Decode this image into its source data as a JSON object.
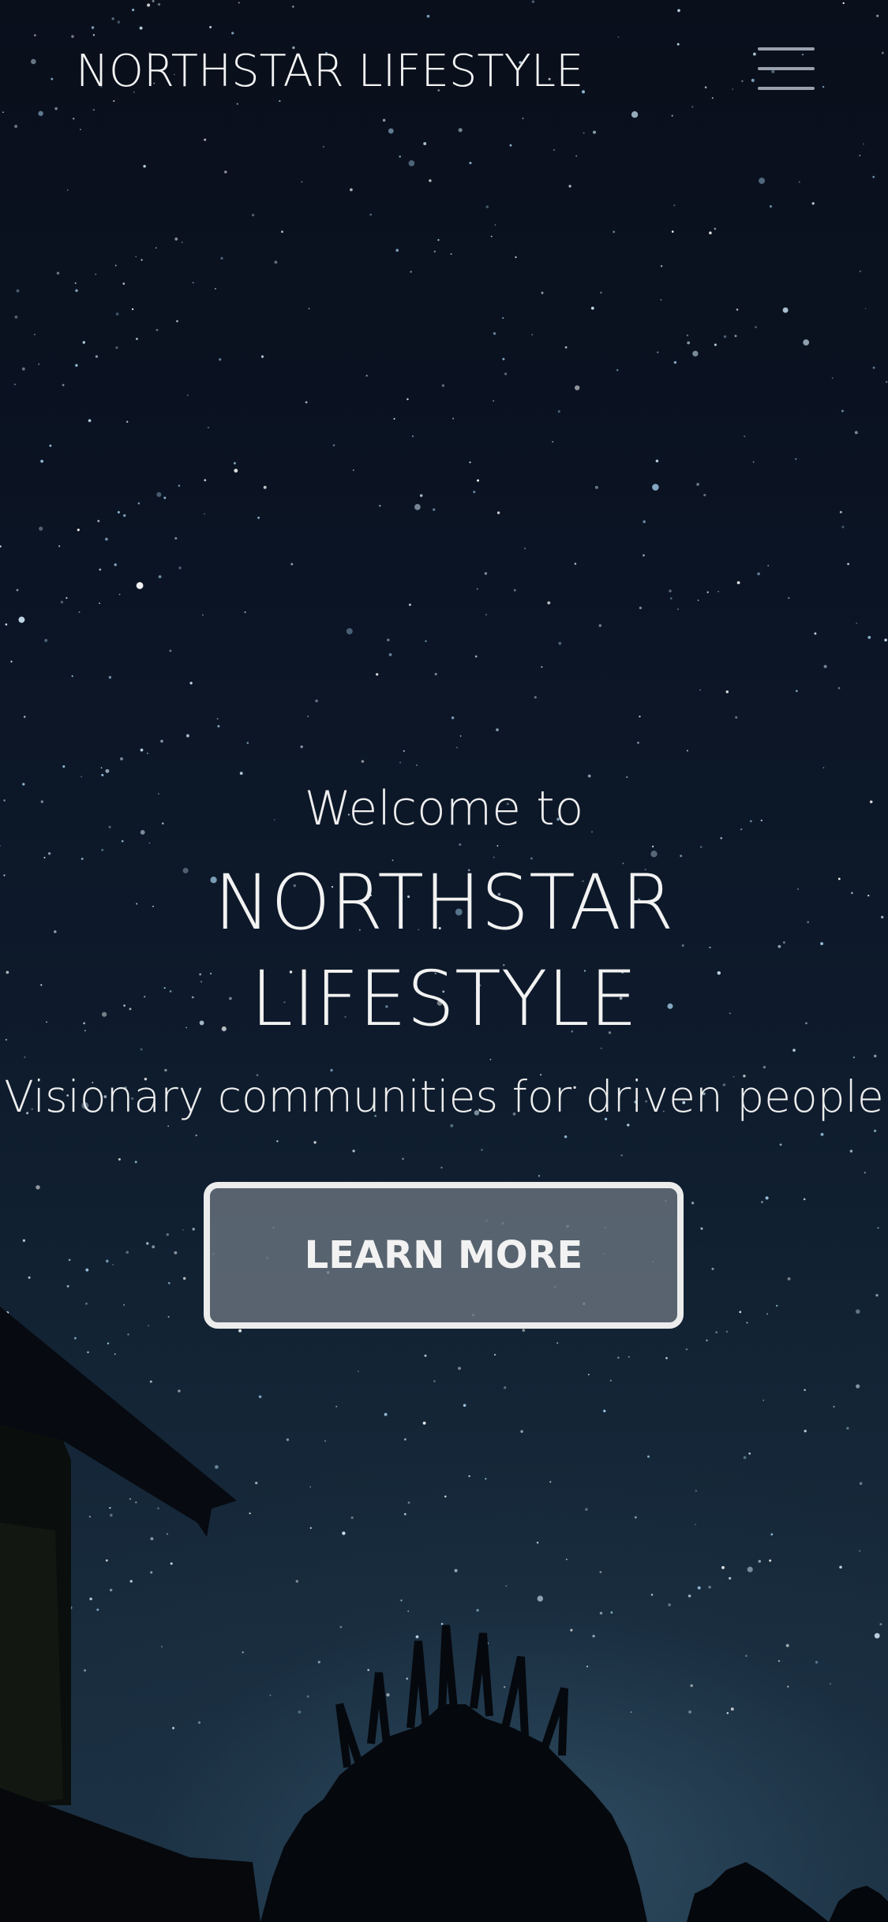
{
  "header": {
    "brand": "NORTHSTAR LIFESTYLE",
    "menu_icon": "hamburger-menu-icon"
  },
  "hero": {
    "welcome": "Welcome to",
    "title_line1": "NORTHSTAR",
    "title_line2": "LIFESTYLE",
    "tagline": "Visionary communities for driven people",
    "cta_label": "LEARN MORE"
  },
  "colors": {
    "sky_top": "#090f1b",
    "sky_bottom": "#1c3244",
    "text": "#f1f1f1",
    "button_fill": "#6c7680",
    "button_border": "#ececec"
  }
}
